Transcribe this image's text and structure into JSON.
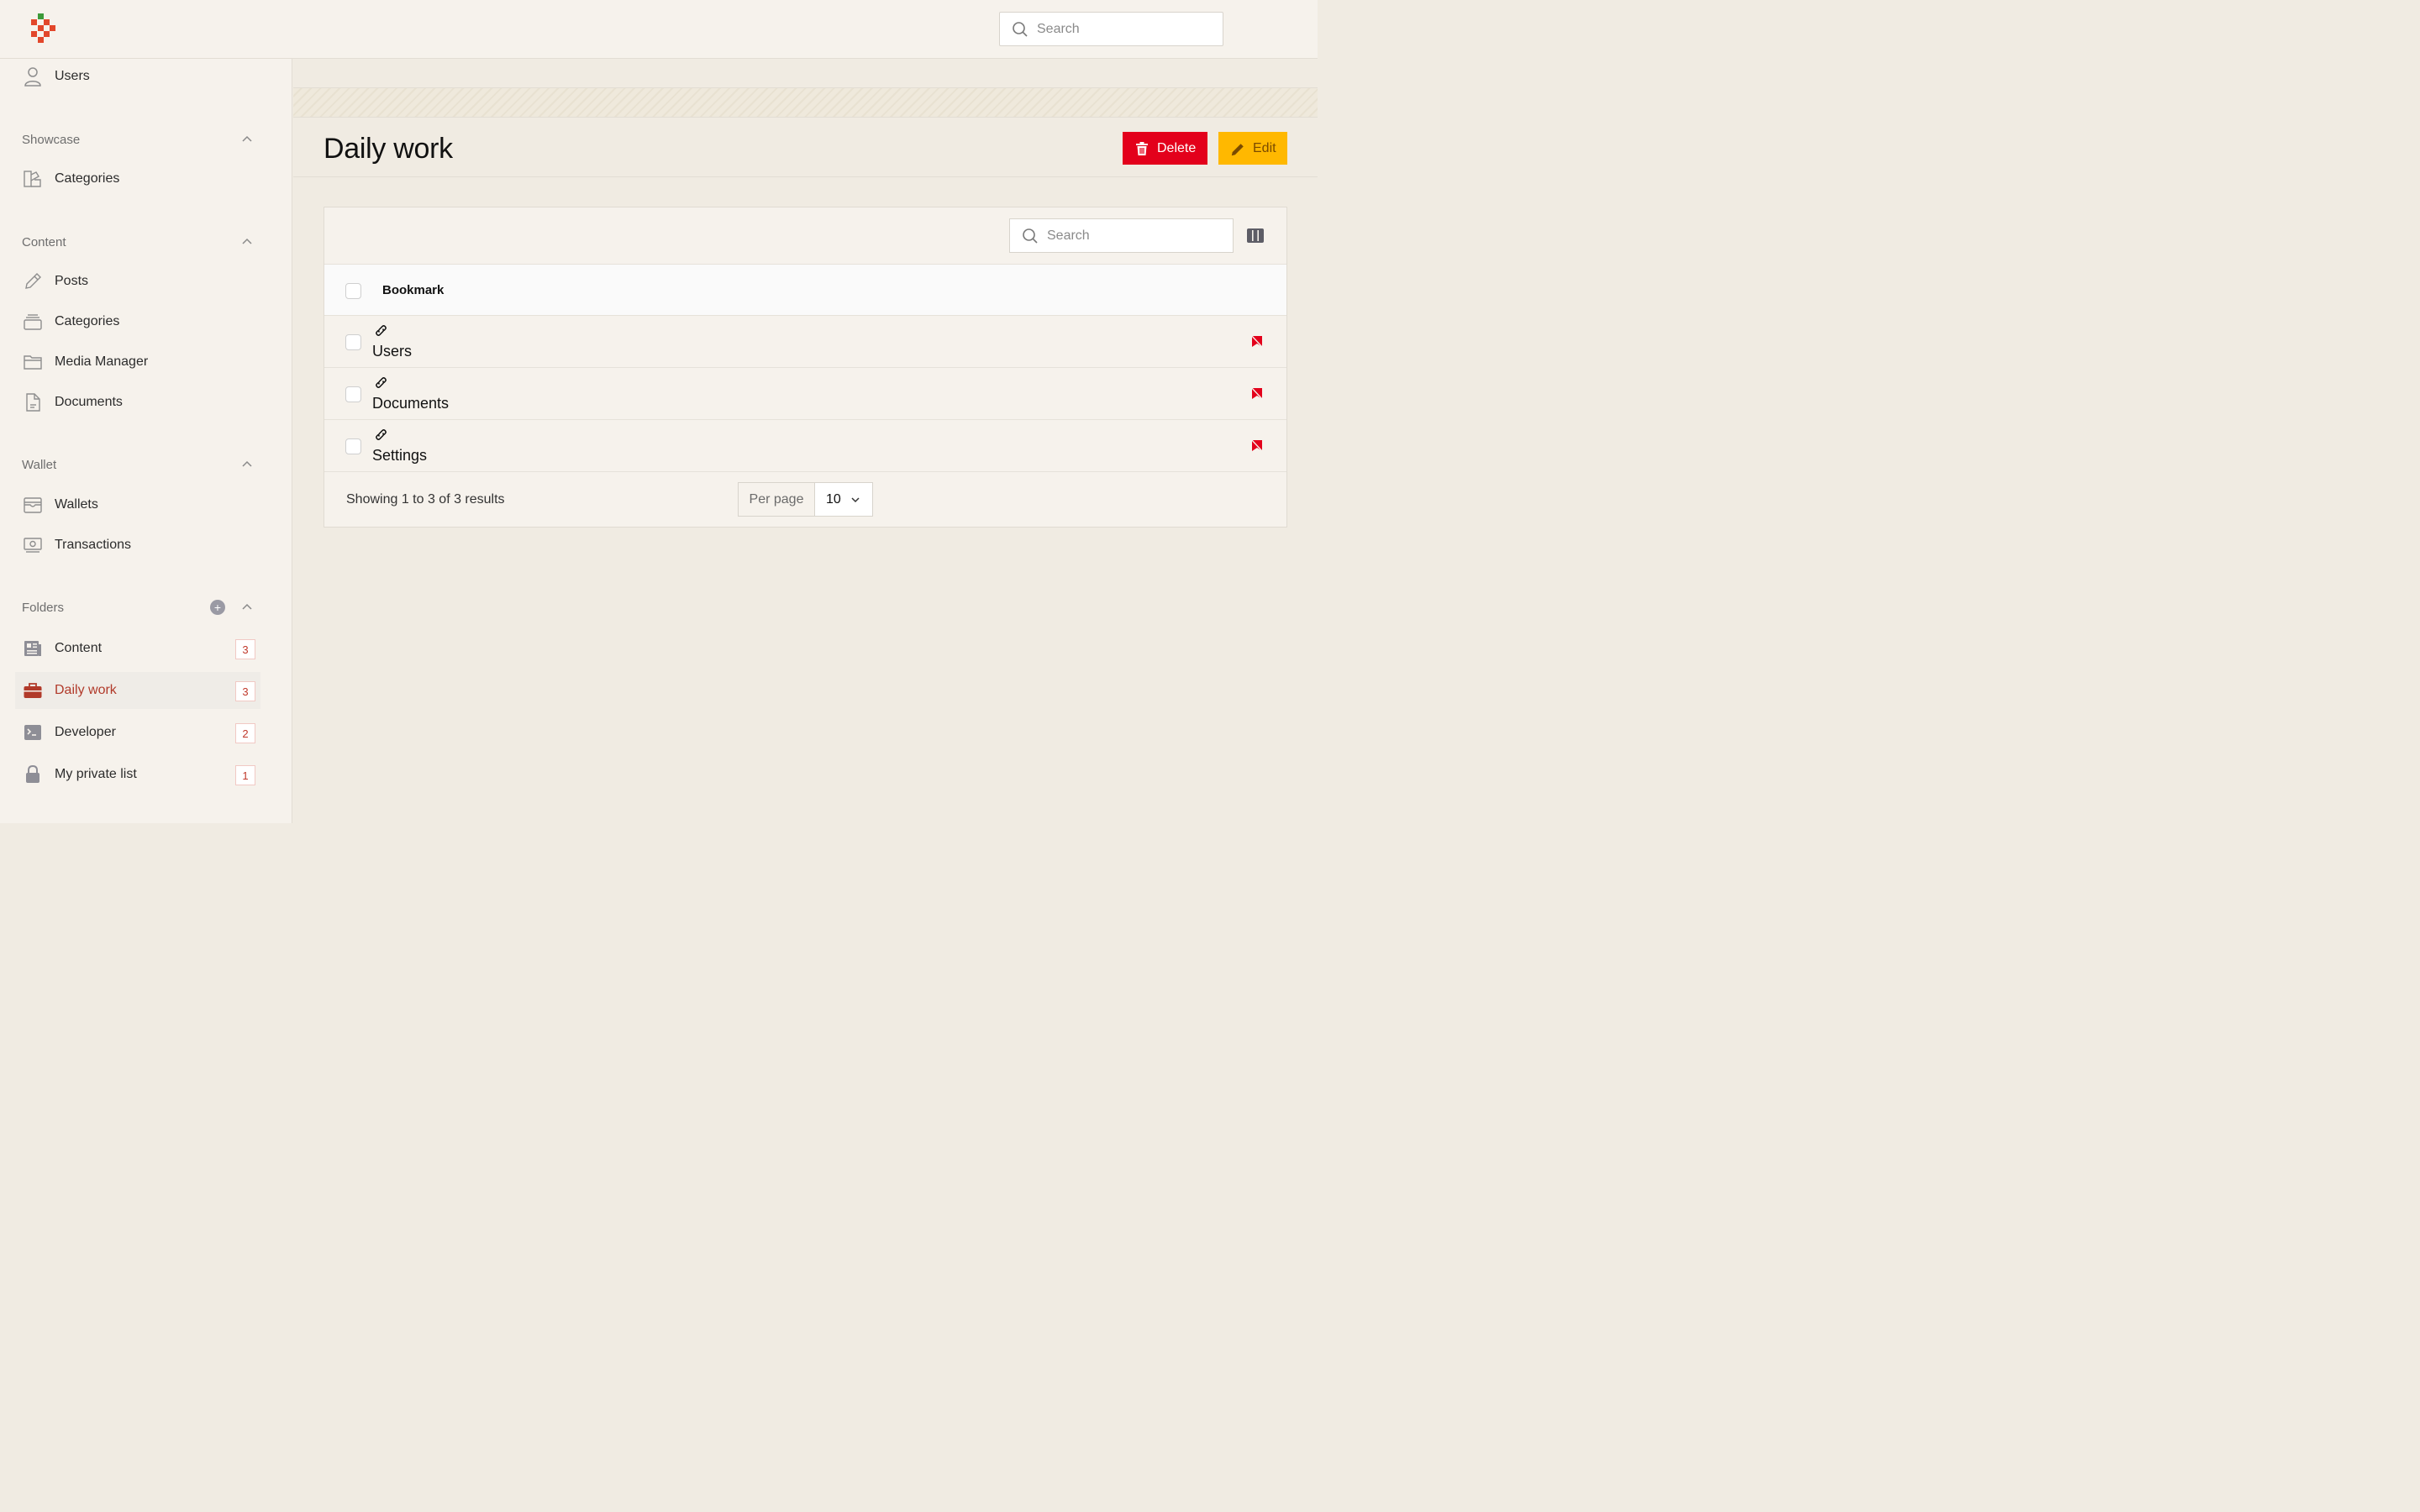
{
  "topbar": {
    "search_placeholder": "Search"
  },
  "sidebar": {
    "top_item": {
      "label": "Users",
      "icon": "user-icon"
    },
    "sections": [
      {
        "title": "Showcase",
        "items": [
          {
            "label": "Categories",
            "icon": "categories-icon"
          }
        ]
      },
      {
        "title": "Content",
        "items": [
          {
            "label": "Posts",
            "icon": "pencil-icon"
          },
          {
            "label": "Categories",
            "icon": "stack-icon"
          },
          {
            "label": "Media Manager",
            "icon": "folder-icon"
          },
          {
            "label": "Documents",
            "icon": "document-icon"
          }
        ]
      },
      {
        "title": "Wallet",
        "items": [
          {
            "label": "Wallets",
            "icon": "wallet-icon"
          },
          {
            "label": "Transactions",
            "icon": "money-icon"
          }
        ]
      }
    ],
    "folders": {
      "title": "Folders",
      "items": [
        {
          "label": "Content",
          "count": "3",
          "icon": "newspaper-icon"
        },
        {
          "label": "Daily work",
          "count": "3",
          "icon": "briefcase-icon",
          "active": true
        },
        {
          "label": "Developer",
          "count": "2",
          "icon": "terminal-icon"
        },
        {
          "label": "My private list",
          "count": "1",
          "icon": "lock-icon"
        }
      ]
    }
  },
  "page": {
    "title": "Daily work",
    "delete_label": "Delete",
    "edit_label": "Edit",
    "accent_delete": "#e3001b",
    "accent_edit": "#ffb800"
  },
  "table": {
    "search_placeholder": "Search",
    "column_header": "Bookmark",
    "rows": [
      {
        "label": "Users"
      },
      {
        "label": "Documents"
      },
      {
        "label": "Settings"
      }
    ],
    "summary": "Showing 1 to 3 of 3 results",
    "per_page_label": "Per page",
    "per_page_value": "10"
  }
}
